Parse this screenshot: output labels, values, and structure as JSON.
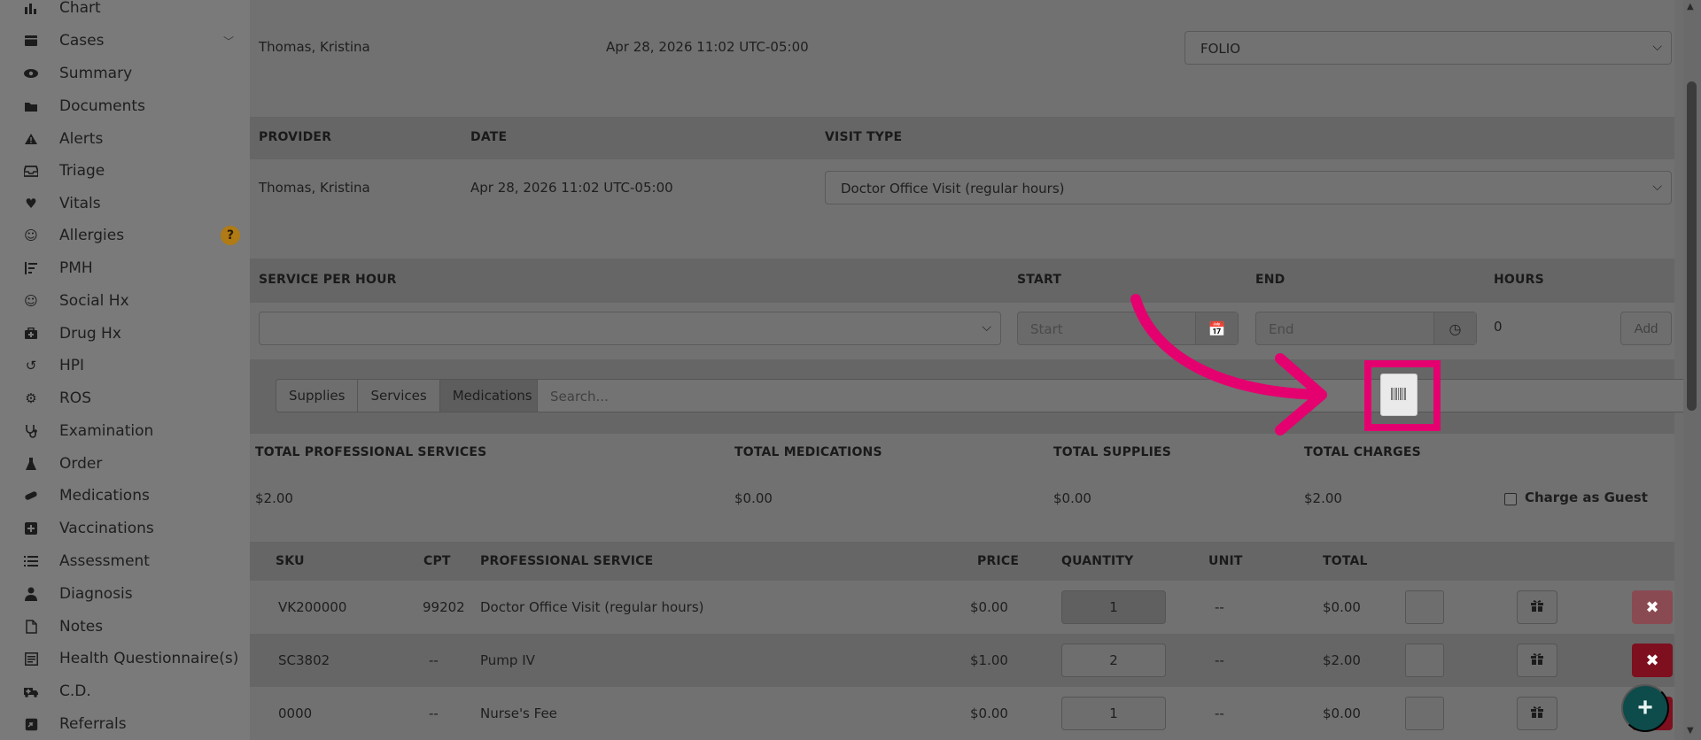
{
  "sidebar": {
    "items": [
      {
        "label": "Chart",
        "icon": "bar-chart-icon"
      },
      {
        "label": "Cases",
        "icon": "folder-case-icon"
      },
      {
        "label": "Summary",
        "icon": "eye-icon"
      },
      {
        "label": "Documents",
        "icon": "folder-icon"
      },
      {
        "label": "Alerts",
        "icon": "warning-icon"
      },
      {
        "label": "Triage",
        "icon": "inbox-icon"
      },
      {
        "label": "Vitals",
        "icon": "heart-icon"
      },
      {
        "label": "Allergies",
        "icon": "smile-icon"
      },
      {
        "label": "PMH",
        "icon": "sort-list-icon"
      },
      {
        "label": "Social Hx",
        "icon": "smile-icon"
      },
      {
        "label": "Drug Hx",
        "icon": "medkit-icon"
      },
      {
        "label": "HPI",
        "icon": "history-icon"
      },
      {
        "label": "ROS",
        "icon": "gear-icon"
      },
      {
        "label": "Examination",
        "icon": "stethoscope-icon"
      },
      {
        "label": "Order",
        "icon": "flask-icon"
      },
      {
        "label": "Medications",
        "icon": "pill-icon"
      },
      {
        "label": "Vaccinations",
        "icon": "plus-square-icon"
      },
      {
        "label": "Assessment",
        "icon": "list-icon"
      },
      {
        "label": "Diagnosis",
        "icon": "doctor-icon"
      },
      {
        "label": "Notes",
        "icon": "file-icon"
      },
      {
        "label": "Health Questionnaire(s)",
        "icon": "form-icon"
      },
      {
        "label": "C.D.",
        "icon": "ambulance-icon"
      },
      {
        "label": "Referrals",
        "icon": "referral-icon"
      }
    ],
    "allergies_badge": "?"
  },
  "created": {
    "name": "Thomas, Kristina",
    "datetime": "Apr 28, 2026 11:02 UTC-05:00",
    "supplement_value": "FOLIO"
  },
  "visit": {
    "headers": {
      "provider": "PROVIDER",
      "date": "DATE",
      "visit_type": "VISIT TYPE"
    },
    "provider": "Thomas, Kristina",
    "date": "Apr 28, 2026 11:02 UTC-05:00",
    "visit_type": "Doctor Office Visit (regular hours)"
  },
  "service_hour": {
    "headers": {
      "service": "SERVICE PER HOUR",
      "start": "START",
      "end": "END",
      "hours": "HOURS"
    },
    "start_placeholder": "Start",
    "end_placeholder": "End",
    "hours": "0",
    "add_label": "Add"
  },
  "catalog": {
    "tabs": [
      "Supplies",
      "Services",
      "Medications"
    ],
    "active_tab": "Medications",
    "search_placeholder": "Search..."
  },
  "totals": {
    "headers": {
      "professional": "TOTAL PROFESSIONAL SERVICES",
      "medications": "TOTAL MEDICATIONS",
      "supplies": "TOTAL SUPPLIES",
      "charges": "TOTAL CHARGES"
    },
    "professional": "$2.00",
    "medications": "$0.00",
    "supplies": "$0.00",
    "charges": "$2.00",
    "guest_label": "Charge as Guest"
  },
  "table": {
    "headers": {
      "sku": "SKU",
      "cpt": "CPT",
      "service": "PROFESSIONAL SERVICE",
      "price": "PRICE",
      "quantity": "QUANTITY",
      "unit": "UNIT",
      "total": "TOTAL"
    },
    "rows": [
      {
        "sku": "VK200000",
        "cpt": "99202",
        "service": "Doctor Office Visit (regular hours)",
        "price": "$0.00",
        "quantity": "1",
        "unit": "--",
        "total": "$0.00"
      },
      {
        "sku": "SC3802",
        "cpt": "--",
        "service": "Pump IV",
        "price": "$1.00",
        "quantity": "2",
        "unit": "--",
        "total": "$2.00"
      },
      {
        "sku": "0000",
        "cpt": "--",
        "service": "Nurse's Fee",
        "price": "$0.00",
        "quantity": "1",
        "unit": "--",
        "total": "$0.00"
      }
    ]
  },
  "colors": {
    "highlight": "#e5006f",
    "fab": "#0e4b4b",
    "delete": "#7e0f1e"
  }
}
